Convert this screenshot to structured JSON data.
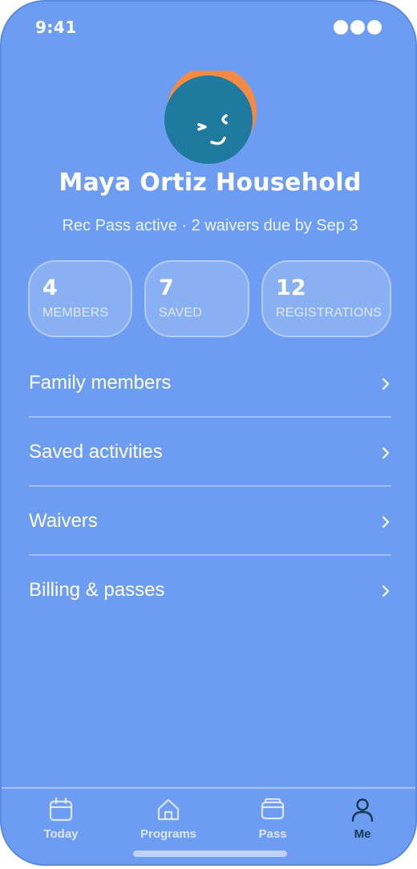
{
  "status_bar": {
    "time": "9:41"
  },
  "profile": {
    "name": "Maya Ortiz Household",
    "subtitle": "Rec Pass active · 2 waivers due by Sep 3",
    "avatar_icon": "winking-face-avatar"
  },
  "stats": [
    {
      "value": "4",
      "label": "MEMBERS"
    },
    {
      "value": "7",
      "label": "SAVED"
    },
    {
      "value": "12",
      "label": "REGISTRATIONS"
    }
  ],
  "menu": [
    {
      "label": "Family members",
      "icon": "chevron-right-icon"
    },
    {
      "label": "Saved activities",
      "icon": "chevron-right-icon"
    },
    {
      "label": "Waivers",
      "icon": "chevron-right-icon"
    },
    {
      "label": "Billing & passes",
      "icon": "chevron-right-icon"
    }
  ],
  "tabs": [
    {
      "label": "Today",
      "icon": "calendar-icon",
      "active": false
    },
    {
      "label": "Programs",
      "icon": "home-icon",
      "active": false
    },
    {
      "label": "Pass",
      "icon": "wallet-icon",
      "active": false
    },
    {
      "label": "Me",
      "icon": "person-icon",
      "active": true
    }
  ],
  "colors": {
    "background": "#6d9df2",
    "avatar_teal": "#1f7a9f",
    "avatar_orange": "#f48a44",
    "active_tab": "#173a52"
  }
}
